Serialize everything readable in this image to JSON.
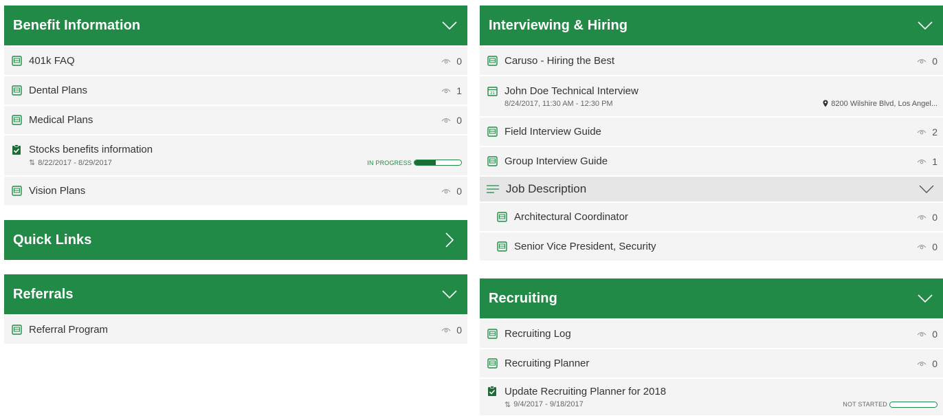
{
  "colors": {
    "accent": "#228a47",
    "accent_dark": "#1d6b37",
    "panel_bg": "#f4f4f4",
    "group_bg": "#e6e6e6"
  },
  "left_panels": {
    "benefits": {
      "title": "Benefit Information",
      "items": [
        {
          "label": "401k FAQ",
          "views": "0",
          "icon": "document-icon"
        },
        {
          "label": "Dental Plans",
          "views": "1",
          "icon": "document-icon"
        },
        {
          "label": "Medical Plans",
          "views": "0",
          "icon": "document-icon"
        },
        {
          "label": "Stocks benefits information",
          "dates": "8/22/2017 - 8/29/2017",
          "status": "IN PROGRESS",
          "progress": 0.45,
          "icon": "task-icon"
        },
        {
          "label": "Vision Plans",
          "views": "0",
          "icon": "document-icon"
        }
      ]
    },
    "quick_links": {
      "title": "Quick Links"
    },
    "referrals": {
      "title": "Referrals",
      "items": [
        {
          "label": "Referral Program",
          "views": "0",
          "icon": "document-icon"
        }
      ]
    }
  },
  "right_panels": {
    "interviewing": {
      "title": "Interviewing & Hiring",
      "items": [
        {
          "label": "Caruso - Hiring the Best",
          "views": "0",
          "icon": "document-icon"
        },
        {
          "label": "John Doe Technical Interview",
          "datetime": "8/24/2017, 11:30 AM - 12:30 PM",
          "location": "8200 Wilshire Blvd, Los Angel...",
          "icon": "calendar-icon"
        },
        {
          "label": "Field Interview Guide",
          "views": "2",
          "icon": "document-icon"
        },
        {
          "label": "Group Interview Guide",
          "views": "1",
          "icon": "document-icon"
        }
      ],
      "group": {
        "label": "Job Description",
        "items": [
          {
            "label": "Architectural Coordinator",
            "views": "0",
            "icon": "document-icon"
          },
          {
            "label": "Senior Vice President, Security",
            "views": "0",
            "icon": "document-icon"
          }
        ]
      }
    },
    "recruiting": {
      "title": "Recruiting",
      "items": [
        {
          "label": "Recruiting Log",
          "views": "0",
          "icon": "document-icon"
        },
        {
          "label": "Recruiting Planner",
          "views": "0",
          "icon": "document-icon"
        },
        {
          "label": "Update Recruiting Planner for 2018",
          "dates": "9/4/2017 - 9/18/2017",
          "status": "NOT STARTED",
          "progress": 0,
          "icon": "task-icon"
        }
      ]
    }
  }
}
